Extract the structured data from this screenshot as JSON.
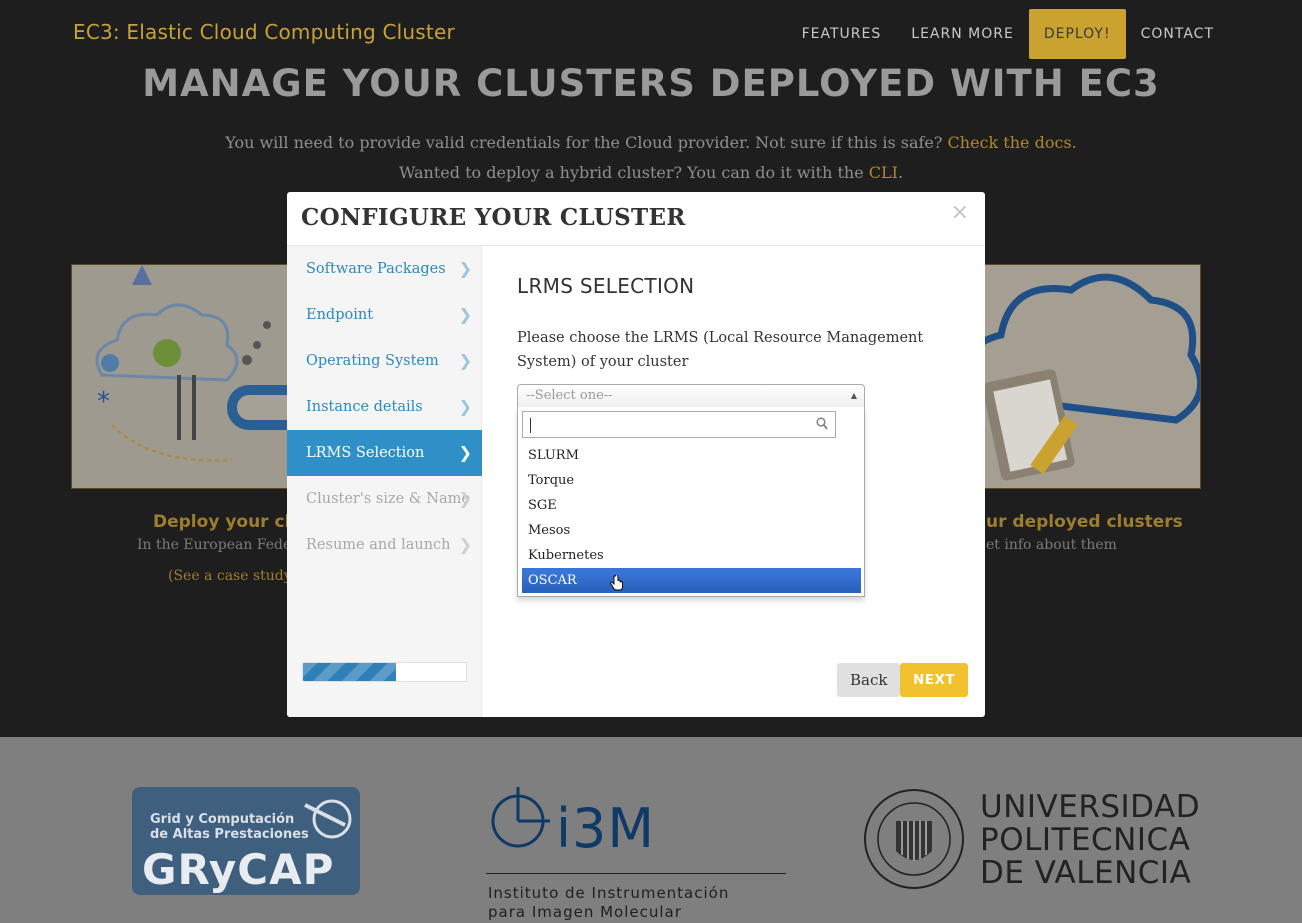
{
  "navbar": {
    "brand": "EC3: Elastic Cloud Computing Cluster",
    "items": [
      {
        "label": "FEATURES"
      },
      {
        "label": "LEARN MORE"
      },
      {
        "label": "DEPLOY!"
      },
      {
        "label": "CONTACT"
      }
    ]
  },
  "hero": {
    "title": "MANAGE YOUR CLUSTERS DEPLOYED WITH EC3",
    "line1_text": "You will need to provide valid credentials for the Cloud provider. Not sure if this is safe? ",
    "line1_link": "Check the docs.",
    "line2_text": "Wanted to deploy a hybrid cluster? You can do it with the ",
    "line2_link": "CLI",
    "line2_end": "."
  },
  "background_cards": {
    "left_title": "Deploy your cl",
    "left_text": "In the European Federa",
    "left_link": "(See a case study",
    "right_title": "ur deployed clusters",
    "right_text": "et info about them"
  },
  "footer": {
    "grycap_line1": "Grid y Computación",
    "grycap_line2": "de Altas Prestaciones",
    "grycap_name": "GRyCAP",
    "i3m_name": "i3M",
    "i3m_sub1": "Instituto de Instrumentación",
    "i3m_sub2": "para Imagen Molecular",
    "upv_line1": "UNIVERSIDAD",
    "upv_line2": "POLITECNICA",
    "upv_line3": "DE VALENCIA"
  },
  "modal": {
    "title": "CONFIGURE YOUR CLUSTER",
    "close": "×",
    "steps": [
      {
        "label": "Software Packages",
        "state": "done"
      },
      {
        "label": "Endpoint",
        "state": "done"
      },
      {
        "label": "Operating System",
        "state": "done"
      },
      {
        "label": "Instance details",
        "state": "done"
      },
      {
        "label": "LRMS Selection",
        "state": "active"
      },
      {
        "label": "Cluster's size & Name",
        "state": "disabled"
      },
      {
        "label": "Resume and launch",
        "state": "disabled"
      }
    ],
    "progress_fraction": 0.57,
    "section_title": "LRMS SELECTION",
    "section_desc": "Please choose the LRMS (Local Resource Management System) of your cluster",
    "select": {
      "placeholder": "--Select one--",
      "search_value": "",
      "options": [
        "SLURM",
        "Torque",
        "SGE",
        "Mesos",
        "Kubernetes",
        "OSCAR"
      ],
      "highlighted": "OSCAR"
    },
    "back_label": "Back",
    "next_label": "NEXT"
  },
  "colors": {
    "accent_gold": "#c9a22f",
    "step_active": "#2f8fc7",
    "next_button": "#f2c12e",
    "option_highlight": "#3875d7"
  },
  "icons": {
    "chevron": "chevron-right-icon",
    "close": "close-icon",
    "search": "search-icon",
    "cursor": "hand-cursor-icon"
  }
}
